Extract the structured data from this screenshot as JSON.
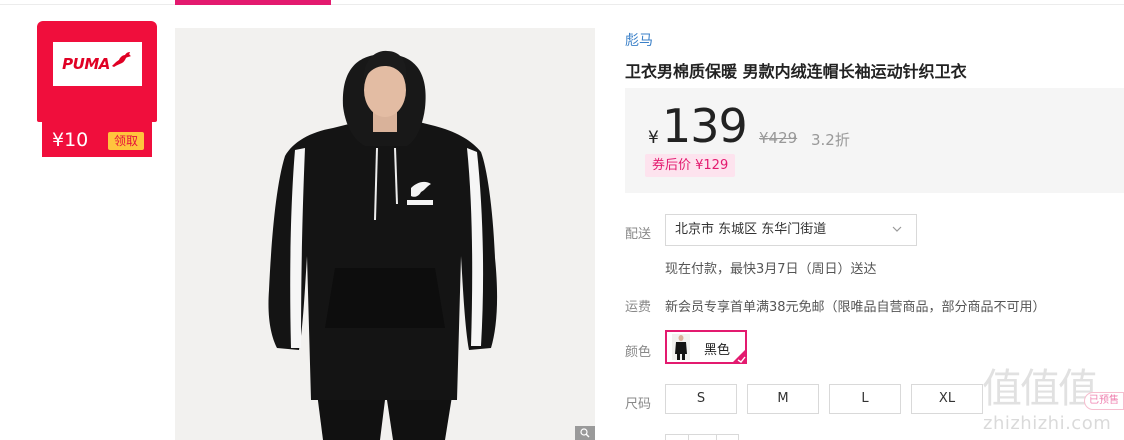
{
  "coupon": {
    "brand_logo_text": "PUMA",
    "amount": "¥10",
    "claim_label": "领取"
  },
  "product": {
    "brand": "彪马",
    "title": "卫衣男棉质保暖 男款内绒连帽长袖运动针织卫衣",
    "currency": "¥",
    "price": "139",
    "original_price": "¥429",
    "discount": "3.2折",
    "coupon_price": "券后价 ¥129"
  },
  "delivery": {
    "label": "配送",
    "address": "北京市 东城区 东华门街道",
    "note": "现在付款，最快3月7日（周日）送达"
  },
  "shipping": {
    "label": "运费",
    "note": "新会员专享首单满38元免邮（限唯品自营商品，部分商品不可用）"
  },
  "color": {
    "label": "颜色",
    "selected": "黑色"
  },
  "size": {
    "label": "尺码",
    "options": [
      "S",
      "M",
      "L",
      "XL"
    ]
  },
  "watermark": {
    "glyphs": "值值值",
    "url": "zhizhizhi.com",
    "pill_text": "已预售"
  },
  "colors": {
    "accent": "#e31a6f",
    "coupon_red": "#f00e3c",
    "claim_yellow": "#ffc43d",
    "brand_link": "#3b80c8"
  }
}
